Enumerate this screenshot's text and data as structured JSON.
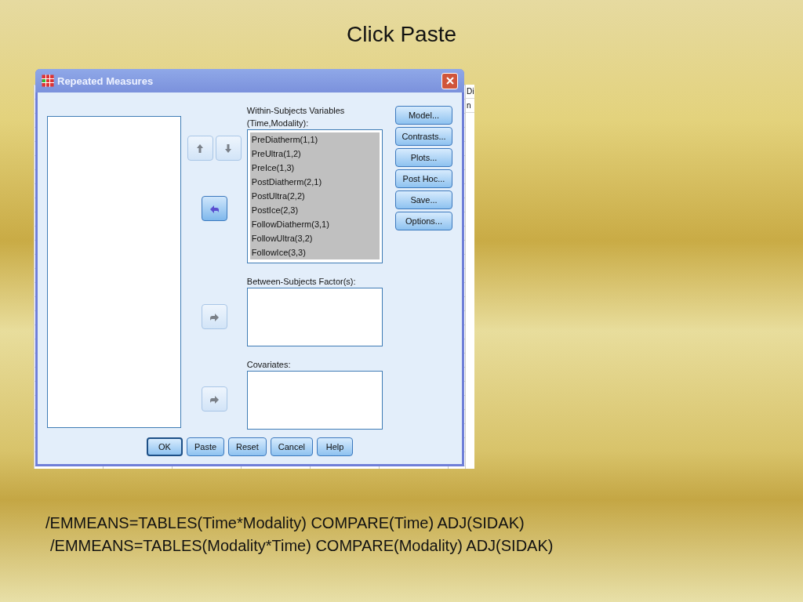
{
  "slide": {
    "title": "Click Paste",
    "code_lines": [
      "/EMMEANS=TABLES(Time*Modality) COMPARE(Time) ADJ(SIDAK)",
      "/EMMEANS=TABLES(Modality*Time) COMPARE(Modality) ADJ(SIDAK)"
    ]
  },
  "background_window": {
    "cells": [
      "Di",
      "n"
    ]
  },
  "dialog": {
    "title": "Repeated Measures",
    "within": {
      "label": "Within-Subjects Variables",
      "sublabel": "(Time,Modality):",
      "items": [
        {
          "text": "PreDiatherm(1,1)",
          "selected": true
        },
        {
          "text": "PreUltra(1,2)",
          "selected": true
        },
        {
          "text": "PreIce(1,3)",
          "selected": true
        },
        {
          "text": "PostDiatherm(2,1)",
          "selected": true
        },
        {
          "text": "PostUltra(2,2)",
          "selected": true
        },
        {
          "text": "PostIce(2,3)",
          "selected": true
        },
        {
          "text": "FollowDiatherm(3,1)",
          "selected": true
        },
        {
          "text": "FollowUltra(3,2)",
          "selected": true
        },
        {
          "text": "FollowIce(3,3)",
          "selected": true
        }
      ]
    },
    "between": {
      "label": "Between-Subjects Factor(s):"
    },
    "covariates": {
      "label": "Covariates:"
    },
    "move_buttons": [
      {
        "kind": "up",
        "disabled": true
      },
      {
        "kind": "down",
        "disabled": true
      },
      {
        "kind": "left",
        "disabled": false
      },
      {
        "kind": "right",
        "disabled": true
      },
      {
        "kind": "right",
        "disabled": true
      }
    ],
    "side_buttons": [
      "Model...",
      "Contrasts...",
      "Plots...",
      "Post Hoc...",
      "Save...",
      "Options..."
    ],
    "bottom_buttons": [
      {
        "label": "OK",
        "default": true
      },
      {
        "label": "Paste",
        "default": false
      },
      {
        "label": "Reset",
        "default": false
      },
      {
        "label": "Cancel",
        "default": false
      },
      {
        "label": "Help",
        "default": false
      }
    ]
  }
}
